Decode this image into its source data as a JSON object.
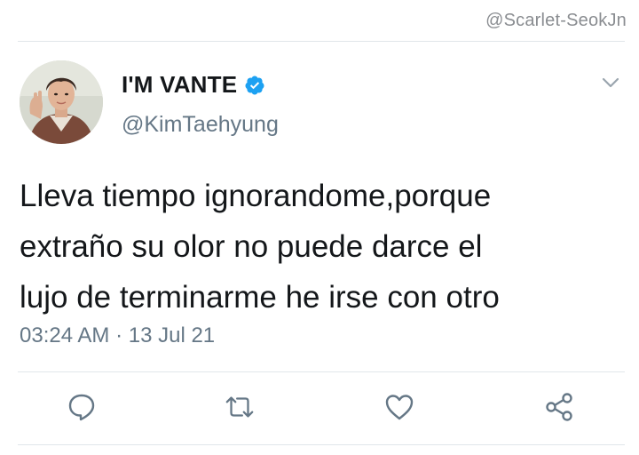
{
  "watermark": "@Scarlet-SeokJn",
  "tweet": {
    "display_name": "I'M VANTE",
    "handle": "@KimTaehyung",
    "verified": true,
    "text_lines": [
      "Lleva tiempo ignorandome,porque",
      "extraño su olor no puede darce el",
      "lujo de terminarme he irse con otro"
    ],
    "time": "03:24 AM",
    "separator": "·",
    "date": "13 Jul 21"
  },
  "actions": [
    {
      "name": "reply",
      "icon": "reply-icon"
    },
    {
      "name": "retweet",
      "icon": "retweet-icon"
    },
    {
      "name": "like",
      "icon": "heart-icon"
    },
    {
      "name": "share",
      "icon": "share-icon"
    }
  ],
  "colors": {
    "text": "#14171a",
    "secondary": "#657786",
    "verified_blue": "#1da1f2",
    "divider": "#e1e6ea"
  }
}
